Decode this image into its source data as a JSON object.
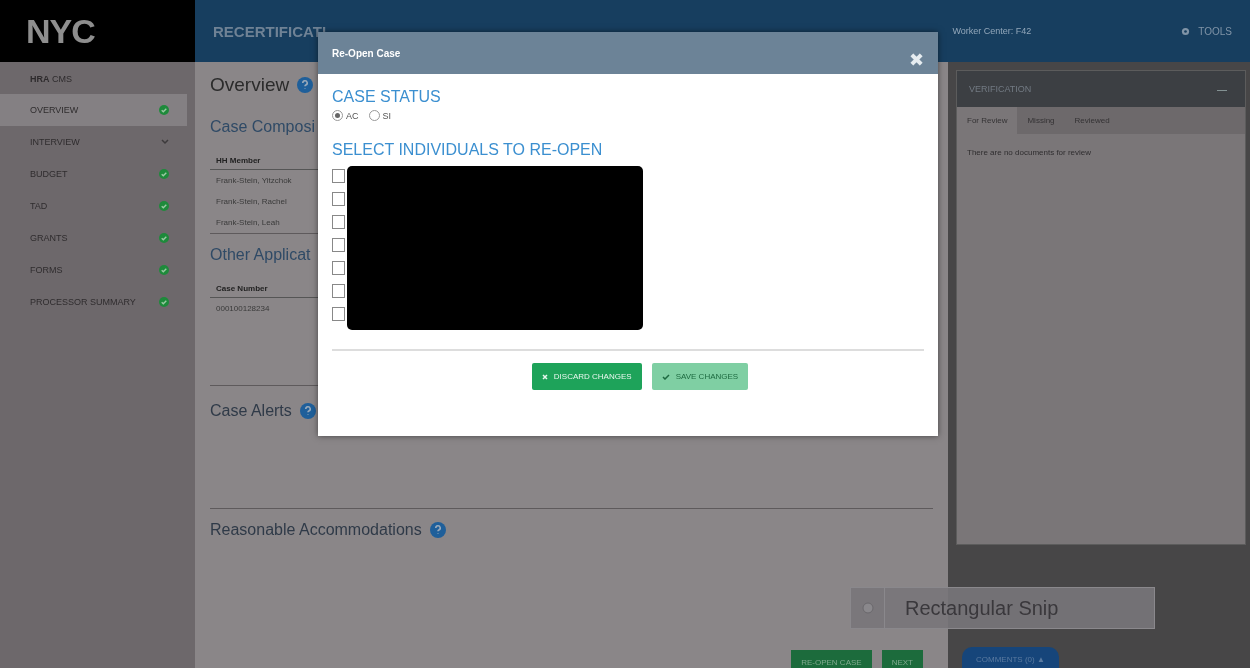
{
  "header": {
    "logo": "NYC",
    "title": "RECERTIFICATI",
    "worker_center": "Worker Center: F42",
    "tools": "TOOLS"
  },
  "sidebar": {
    "title_bold": "HRA",
    "title": "CMS",
    "items": [
      {
        "label": "OVERVIEW",
        "kind": "done",
        "selected": true
      },
      {
        "label": "INTERVIEW",
        "kind": "expandable",
        "selected": false
      },
      {
        "label": "BUDGET",
        "kind": "done",
        "selected": false
      },
      {
        "label": "TAD",
        "kind": "done",
        "selected": false
      },
      {
        "label": "GRANTS",
        "kind": "done",
        "selected": false
      },
      {
        "label": "FORMS",
        "kind": "done",
        "selected": false
      },
      {
        "label": "PROCESSOR SUMMARY",
        "kind": "done",
        "selected": false
      }
    ]
  },
  "main": {
    "title": "Overview",
    "case_composition": {
      "title": "Case Composi",
      "column": "HH Member",
      "rows": [
        "Frank-Stein, Yitzchok",
        "Frank-Stein, Rachel",
        "Frank-Stein, Leah"
      ]
    },
    "other_applications": {
      "title": "Other Applicat",
      "column": "Case Number",
      "rows": [
        "000100128234"
      ]
    },
    "case_alerts": "Case Alerts",
    "accommodations": "Reasonable Accommodations",
    "buttons": [
      "RE-OPEN CASE",
      "NEXT"
    ]
  },
  "verification": {
    "title": "VERIFICATION",
    "minimize": "—",
    "tabs": [
      {
        "label": "For Review",
        "selected": true
      },
      {
        "label": "Missing",
        "selected": false
      },
      {
        "label": "Reviewed",
        "selected": false
      }
    ],
    "message": "There are no documents for review",
    "comments": "COMMENTS (0) ▲"
  },
  "modal": {
    "title": "Re-Open Case",
    "close": "✖",
    "status_title": "CASE STATUS",
    "statuses": [
      {
        "label": "AC",
        "selected": true
      },
      {
        "label": "SI",
        "selected": false
      }
    ],
    "select_title": "SELECT INDIVIDUALS TO RE-OPEN",
    "individuals": [
      {
        "checked": false
      },
      {
        "checked": false
      },
      {
        "checked": false
      },
      {
        "checked": false
      },
      {
        "checked": false
      },
      {
        "checked": false
      },
      {
        "checked": false
      }
    ],
    "buttons": [
      {
        "label": "DISCARD CHANGES",
        "kind": "discard",
        "disabled": false
      },
      {
        "label": "SAVE CHANGES",
        "kind": "save",
        "disabled": true
      }
    ]
  },
  "snip_toolbar": {
    "label": "Rectangular Snip"
  }
}
